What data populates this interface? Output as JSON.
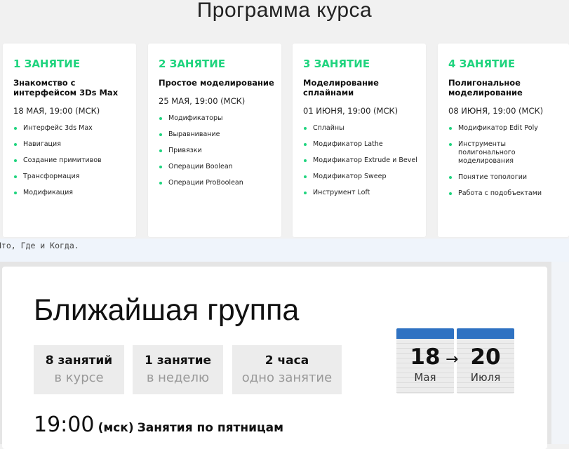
{
  "page_title": "Программа курса",
  "lessons": [
    {
      "number": "1 ЗАНЯТИЕ",
      "title": "Знакомство с интерфейсом 3Ds Max",
      "date": "18 МАЯ, 19:00 (МСК)",
      "topics": [
        "Интерфейс 3ds Max",
        "Навигация",
        "Создание примитивов",
        "Трансформация",
        "Модификация"
      ]
    },
    {
      "number": "2 ЗАНЯТИЕ",
      "title": "Простое моделирование",
      "date": "25 МАЯ, 19:00 (МСК)",
      "topics": [
        "Модификаторы",
        "Выравнивание",
        "Привязки",
        "Операции Boolean",
        "Операции ProBoolean"
      ]
    },
    {
      "number": "3 ЗАНЯТИЕ",
      "title": "Моделирование сплайнами",
      "date": "01 ИЮНЯ, 19:00 (МСК)",
      "topics": [
        "Сплайны",
        "Модификатор Lathe",
        "Модификатор Extrude и Bevel",
        "Модификатор Sweep",
        "Инструмент Loft"
      ]
    },
    {
      "number": "4 ЗАНЯТИЕ",
      "title": "Полигональное моделирование",
      "date": "08 ИЮНЯ, 19:00 (МСК)",
      "topics": [
        "Модификатор Edit Poly",
        "Инструменты полигонального моделирования",
        "Понятие топологии",
        "Работа с подобъектами"
      ]
    }
  ],
  "info_text": "Что, Где и Когда.",
  "group": {
    "title": "Ближайшая группа",
    "stats": [
      {
        "main": "8 занятий",
        "sub": "в курсе"
      },
      {
        "main": "1 занятие",
        "sub": "в неделю"
      },
      {
        "main": "2 часа",
        "sub": "одно занятие"
      }
    ],
    "time": "19:00",
    "timezone": "(мск)",
    "schedule": "Занятия по пятницам",
    "calendar_start": {
      "day": "18",
      "month": "Мая"
    },
    "calendar_end": {
      "day": "20",
      "month": "Июля"
    },
    "arrow": "→"
  },
  "colors": {
    "accent": "#1fd47e",
    "calendar_header": "#2f72c2"
  }
}
